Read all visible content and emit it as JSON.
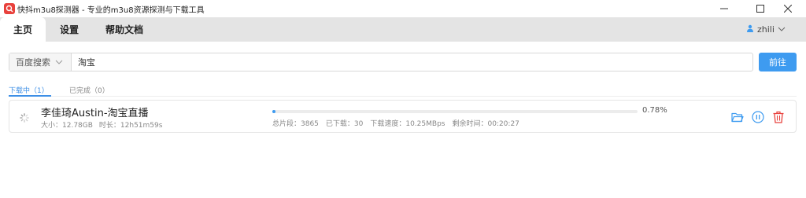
{
  "window": {
    "title": "快抖m3u8探测器 - 专业的m3u8资源探测与下载工具",
    "app_icon": "app-logo-icon",
    "controls": [
      "minimize-icon",
      "maximize-icon",
      "close-icon"
    ]
  },
  "tabs": [
    {
      "label": "主页",
      "active": true
    },
    {
      "label": "设置",
      "active": false
    },
    {
      "label": "帮助文档",
      "active": false
    }
  ],
  "user": {
    "name": "zhili",
    "icon": "user-icon"
  },
  "search": {
    "engine": "百度搜索",
    "value": "淘宝",
    "button": "前往"
  },
  "subtabs": {
    "downloading": "下载中（1）",
    "completed": "已完成（0）"
  },
  "tasks": [
    {
      "name": "李佳琦Austin-淘宝直播",
      "size": "大小：12.78GB",
      "duration": "时长：12h51m59s",
      "progress_percent": 0.78,
      "progress_text": "0.78%",
      "total_segments": "总片段：3865",
      "downloaded": "已下载：30",
      "speed": "下载速度：10.25MBps",
      "remaining": "剩余时间：00:20:27"
    }
  ],
  "colors": {
    "accent": "#3e9bf0",
    "tab_bar": "#e4e4e4",
    "delete": "#e8413c"
  }
}
